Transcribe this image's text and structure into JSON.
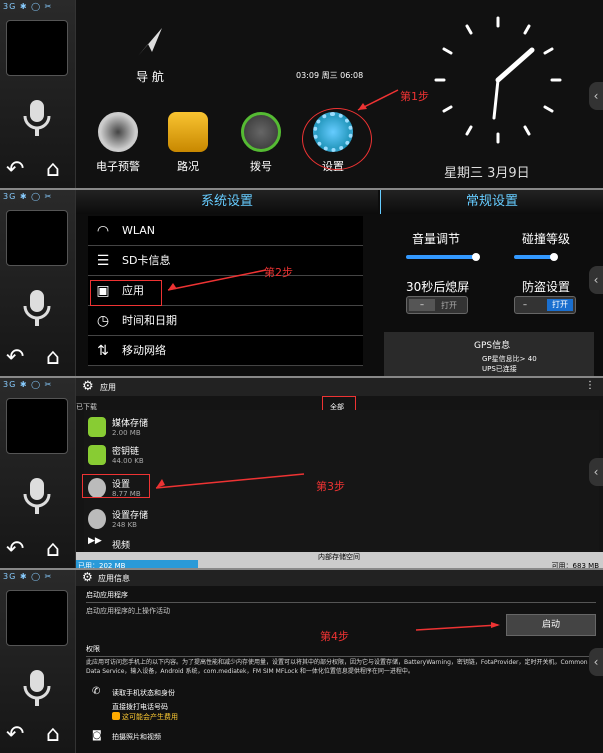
{
  "status_icons": "3G ✱ ◯ ✂",
  "panel1": {
    "nav_label": "导 航",
    "time_text": "03:09 周三 06:08",
    "apps": [
      {
        "label": "电子预警"
      },
      {
        "label": "路况"
      },
      {
        "label": "拨号"
      },
      {
        "label": "设置"
      }
    ],
    "step": "第1步",
    "date": "星期三 3月9日"
  },
  "panel2": {
    "left_title": "系统设置",
    "right_title": "常规设置",
    "list": [
      "WLAN",
      "SD卡信息",
      "应用",
      "时间和日期",
      "移动网络"
    ],
    "step": "第2步",
    "volume": "音量调节",
    "collision": "碰撞等级",
    "auto_off": "30秒后熄屏",
    "anti_theft": "防盗设置",
    "toggle_off": "打开",
    "toggle_on": "打开",
    "gps_title": "GPS信息",
    "gps_line1": "GP星信息比> 40",
    "gps_line2": "UPS已连接"
  },
  "panel3": {
    "title": "应用",
    "tab_left": "已下载",
    "tab_right": "全部",
    "apps": [
      {
        "name": "媒体存储",
        "size": "2.00 MB"
      },
      {
        "name": "密钥链",
        "size": "44.00 KB"
      },
      {
        "name": "设置",
        "size": "8.77 MB"
      },
      {
        "name": "设置存储",
        "size": "248 KB"
      },
      {
        "name": "视频",
        "size": ""
      }
    ],
    "step": "第3步",
    "storage_mid": "内部存储空间",
    "storage_used": "已用：202 MB",
    "storage_free": "可用：683 MB"
  },
  "panel4": {
    "title": "应用信息",
    "section_launch": "启动应用程序",
    "launch_desc": "启动应用程序的上操作活动",
    "launch_button": "启动",
    "step": "第4步",
    "perm_title": "权限",
    "perm_desc": "此应用可访问您手机上的以下内容。为了提高性能和减少内存使用量，设置可以将其中的部分权限，因为它与设置存储，BatteryWarning，密钥链，FotaProvider，定时开关机，Common Data Service，输入设备，Android 系统，com.mediatek，FM SIM MFLock 和一体化位置信息提供程序在同一进程中。",
    "perm1": "读取手机状态和身份",
    "perm2": "直接拨打电话号码",
    "perm3": "这可能会产生费用",
    "perm4": "拍摄照片和视频"
  }
}
